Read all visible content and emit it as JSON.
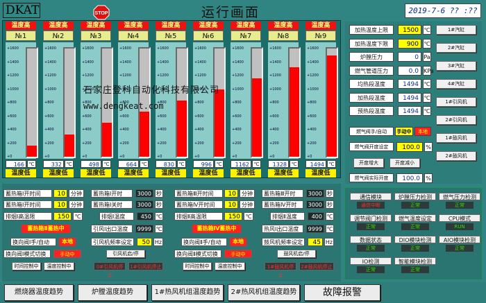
{
  "header": {
    "brand": "DKAT",
    "stop_label": "STOP",
    "title": "运行画面",
    "clock": "2019-7-6 ?? :??"
  },
  "gauges": {
    "head_label": "温度高",
    "foot_label": "温度低",
    "unit": "℃",
    "ticks": [
      "+1600",
      "+1400",
      "+1200",
      "+1000",
      "+800",
      "+600",
      "+400",
      "+200",
      "+0"
    ],
    "items": [
      {
        "name": "№1",
        "value": "166",
        "level": 0.104
      },
      {
        "name": "№2",
        "value": "332",
        "level": 0.2075
      },
      {
        "name": "№3",
        "value": "498",
        "level": 0.311
      },
      {
        "name": "№4",
        "value": "664",
        "level": 0.415
      },
      {
        "name": "№5",
        "value": "830",
        "level": 0.519
      },
      {
        "name": "№6",
        "value": "996",
        "level": 0.6225
      },
      {
        "name": "№7",
        "value": "1162",
        "level": 0.726
      },
      {
        "name": "№8",
        "value": "1328",
        "level": 0.83
      },
      {
        "name": "№9",
        "value": "1494",
        "level": 0.934
      }
    ]
  },
  "watermark": {
    "line1": "石家庄登科自动化科技有限公司",
    "line2": "www.dengkeat.com"
  },
  "right": {
    "rows": [
      {
        "label": "加热温度上限",
        "value": "1500",
        "unit": "℃"
      },
      {
        "label": "加热温度下限",
        "value": "900",
        "unit": "℃"
      },
      {
        "label": "炉膛压力",
        "value": "0",
        "unit": "Pa"
      },
      {
        "label": "燃气管道压力",
        "value": "0.0",
        "unit": "KPa"
      },
      {
        "label": "均热段温度",
        "value": "1494",
        "unit": "℃"
      },
      {
        "label": "加热段温度",
        "value": "1494",
        "unit": "℃"
      },
      {
        "label": "预热段温度",
        "value": "1494",
        "unit": "℃"
      }
    ],
    "side_buttons": [
      "1#汽缸",
      "2#汽缸",
      "3#汽缸",
      "4#汽缸",
      "1#引风机",
      "2#引风机",
      "1#鼓风机",
      "2#鼓风机"
    ],
    "valve_mode_label": "燃气阀手/自动",
    "valve_mode_manual": "手动中",
    "valve_mode_local": "本地",
    "valve_open_label": "燃气阀开度设定",
    "valve_open_value": "100.0",
    "valve_open_unit": "%",
    "increase_label": "开度增大",
    "decrease_label": "开度减小",
    "valve_actual_label": "燃气阀实际开度",
    "valve_actual_value": "100.0",
    "valve_actual_unit": "%"
  },
  "bottom": {
    "a1_on_label": "蓄热箱Ⅰ开时间",
    "a1_on_value": "10",
    "a1_on_unit": "分钟",
    "a1_off_label": "蓄热箱Ⅰ开时间",
    "a1_off_value": "10",
    "a1_off_unit": "分钟",
    "a1_smoke_label": "排烟Ⅰ高温限",
    "a1_smoke_value": "150",
    "a1_smoke_unit": "℃",
    "a1_status": "蓄热箱Ⅱ蓄热中",
    "a1_valve_label": "换向阀Ⅰ手/自动",
    "a1_valve_state": "本地",
    "a1_mode_label": "换向阀Ⅰ模式切换",
    "a1_mode_state": "手动中",
    "a1_time_label": "时间控制中",
    "a1_temp_label": "温度控制中",
    "b1_on_label": "蓄热箱Ⅰ开时",
    "b1_on_value": "3000",
    "b1_on_unit": "秒",
    "b1_off_label": "蓄热箱Ⅰ关时",
    "b1_off_value": "3000",
    "b1_off_unit": "秒",
    "b1_smoke_label": "排烟Ⅰ温度",
    "b1_smoke_value": "450",
    "b1_smoke_unit": "℃",
    "b1_outlet_label": "引风Ⅰ出口温度",
    "b1_outlet_value": "9999",
    "b1_outlet_unit": "℃",
    "b1_freq_label": "引风机频率设定",
    "b1_freq_value": "50",
    "b1_freq_unit": "Hz",
    "b1_fan_btn": "引风机启/停",
    "b1_fan_state": "0#引风机停止",
    "b1_fan_state2": "1#引风机停止",
    "a2_on_label": "蓄热箱Ⅲ开时间",
    "a2_on_value": "10",
    "a2_on_unit": "分钟",
    "a2_off_label": "蓄热箱Ⅳ开时间",
    "a2_off_value": "10",
    "a2_off_unit": "分钟",
    "a2_smoke_label": "排烟Ⅱ高温限",
    "a2_smoke_value": "150",
    "a2_smoke_unit": "℃",
    "a2_status": "蓄热箱Ⅳ蓄热中",
    "a2_valve_label": "换向阀Ⅱ手/自动",
    "a2_valve_state": "本地",
    "a2_mode_label": "换向阀Ⅱ模式切换",
    "a2_mode_state": "手动中",
    "a2_time_label": "时间控制中",
    "a2_temp_label": "温度控制中",
    "b2_on_label": "蓄热箱Ⅲ开时",
    "b2_on_value": "3000",
    "b2_on_unit": "秒",
    "b2_off_label": "蓄热箱Ⅳ开时",
    "b2_off_value": "3000",
    "b2_off_unit": "秒",
    "b2_smoke_label": "排烟Ⅱ温度",
    "b2_smoke_value": "400",
    "b2_smoke_unit": "℃",
    "b2_outlet_label": "热风Ⅰ出口温度",
    "b2_outlet_value": "9999",
    "b2_outlet_unit": "℃",
    "b2_freq_label": "鼓风机频率设定",
    "b2_freq_value": "45",
    "b2_freq_unit": "Hz",
    "b2_fan_btn": "鼓风机启/停",
    "b2_fan_state": "1#鼓风机停止",
    "b2_fan_state2": "2#鼓风机停止"
  },
  "status": {
    "items": [
      {
        "name": "通信模块",
        "value": "通信中断",
        "err": true
      },
      {
        "name": "炉膛压力检测",
        "value": "正常",
        "err": false
      },
      {
        "name": "燃气压力检测",
        "value": "正常",
        "err": false
      },
      {
        "name": "调节阀门检测",
        "value": "正常",
        "err": false
      },
      {
        "name": "燃气温度设定",
        "value": "正常",
        "err": false
      },
      {
        "name": "CPU模式",
        "value": "RUN",
        "err": false
      },
      {
        "name": "数据状态",
        "value": "正常",
        "err": false
      },
      {
        "name": "DIO模块检测",
        "value": "正常",
        "err": false
      },
      {
        "name": "AIO模块检测",
        "value": "正常",
        "err": false
      },
      {
        "name": "IO检测",
        "value": "正常",
        "err": false
      },
      {
        "name": "智能模块检测",
        "value": "正常",
        "err": false
      }
    ]
  },
  "footer": {
    "b1": "燃烧器温度趋势",
    "b2": "炉膛温度趋势",
    "b3": "1#热风机组温度趋势",
    "b4": "2#热风机组温度趋势",
    "b5": "故障报警"
  }
}
